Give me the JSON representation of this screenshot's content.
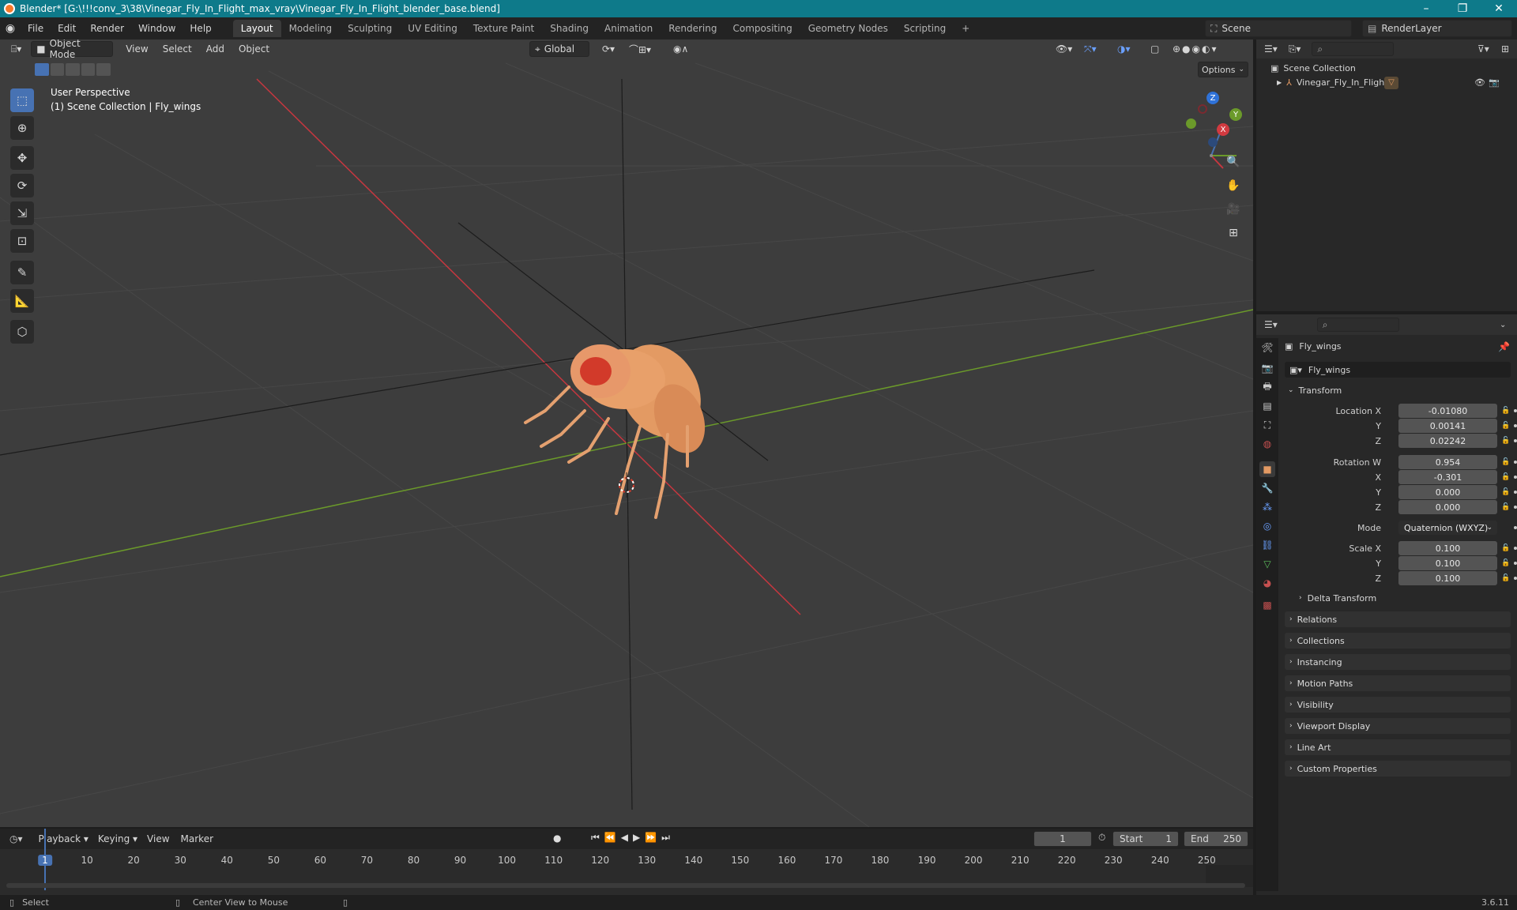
{
  "titlebar": {
    "title": "Blender* [G:\\!!!conv_3\\38\\Vinegar_Fly_In_Flight_max_vray\\Vinegar_Fly_In_Flight_blender_base.blend]",
    "minimize": "–",
    "maximize": "❐",
    "close": "✕"
  },
  "menubar": {
    "menus": [
      "File",
      "Edit",
      "Render",
      "Window",
      "Help"
    ],
    "workspaces": [
      "Layout",
      "Modeling",
      "Sculpting",
      "UV Editing",
      "Texture Paint",
      "Shading",
      "Animation",
      "Rendering",
      "Compositing",
      "Geometry Nodes",
      "Scripting"
    ],
    "add_tab": "+",
    "scene_label": "Scene",
    "renderlayer_label": "RenderLayer"
  },
  "viewport": {
    "mode": "Object Mode",
    "menus": [
      "View",
      "Select",
      "Add",
      "Object"
    ],
    "orientation": "Global",
    "options_label": "Options",
    "overlay_title": "User Perspective",
    "overlay_subtitle": "(1) Scene Collection | Fly_wings",
    "gizmo": {
      "x": "X",
      "y": "Y",
      "z": "Z"
    }
  },
  "outliner": {
    "root": "Scene Collection",
    "items": [
      {
        "label": "Vinegar_Fly_In_Flight"
      }
    ]
  },
  "properties": {
    "object_name": "Fly_wings",
    "data_name": "Fly_wings",
    "transform_label": "Transform",
    "location": {
      "label_x": "Location X",
      "label_y": "Y",
      "label_z": "Z",
      "x": "-0.01080",
      "y": "0.00141",
      "z": "0.02242"
    },
    "rotation": {
      "label_w": "Rotation W",
      "label_x": "X",
      "label_y": "Y",
      "label_z": "Z",
      "w": "0.954",
      "x": "-0.301",
      "y": "0.000",
      "z": "0.000"
    },
    "mode_label": "Mode",
    "mode_value": "Quaternion (WXYZ)",
    "scale": {
      "label_x": "Scale X",
      "label_y": "Y",
      "label_z": "Z",
      "x": "0.100",
      "y": "0.100",
      "z": "0.100"
    },
    "delta_transform": "Delta Transform",
    "panels": [
      "Relations",
      "Collections",
      "Instancing",
      "Motion Paths",
      "Visibility",
      "Viewport Display",
      "Line Art",
      "Custom Properties"
    ]
  },
  "timeline": {
    "menus": [
      "Playback",
      "Keying",
      "View",
      "Marker"
    ],
    "current_frame": "1",
    "start_label": "Start",
    "start": "1",
    "end_label": "End",
    "end": "250",
    "ticks": [
      "1",
      "10",
      "20",
      "30",
      "40",
      "50",
      "60",
      "70",
      "80",
      "90",
      "100",
      "110",
      "120",
      "130",
      "140",
      "150",
      "160",
      "170",
      "180",
      "190",
      "200",
      "210",
      "220",
      "230",
      "240",
      "250"
    ]
  },
  "statusbar": {
    "select": "Select",
    "center_view": "Center View to Mouse",
    "version": "3.6.11"
  },
  "colors": {
    "accent_blue": "#4772b3",
    "axis_x": "#c6373f",
    "axis_y": "#6b9a2a",
    "fly_body": "#e8a06a",
    "fly_eye": "#d23a2a"
  }
}
